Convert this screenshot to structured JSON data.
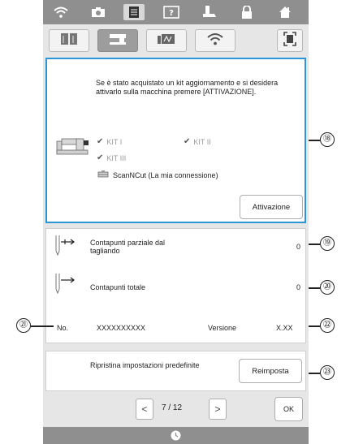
{
  "panel1": {
    "message": "Se è stato acquistato un kit aggiornamento e si desidera attivarlo sulla macchina premere [ATTIVAZIONE].",
    "kits": [
      "KIT I",
      "KIT II",
      "KIT III"
    ],
    "scanncut_label": "ScanNCut (La mia connessione)",
    "activate_label": "Attivazione"
  },
  "counters": {
    "partial_label": "Contapunti parziale dal tagliando",
    "partial_value": "0",
    "total_label": "Contapunti totale",
    "total_value": "0"
  },
  "info": {
    "no_label": "No.",
    "no_value": "XXXXXXXXXX",
    "version_label": "Versione",
    "version_value": "X.XX"
  },
  "reset": {
    "label": "Ripristina impostazioni predefinite",
    "button_label": "Reimposta"
  },
  "pagination": {
    "prev": "<",
    "current": "7",
    "separator": "/",
    "total": "12",
    "next": ">",
    "ok_label": "OK"
  },
  "callouts": [
    "⑱",
    "⑲",
    "⑳",
    "㉑",
    "㉒",
    "㉓"
  ],
  "icons": {
    "top": [
      "wifi-icon",
      "camera-icon",
      "settings-page-icon",
      "help-icon",
      "presser-foot-icon",
      "lock-icon",
      "home-icon"
    ],
    "tabs": [
      "book-settings-icon",
      "machine-settings-icon",
      "embroidery-settings-icon",
      "wireless-icon",
      "fullscreen-icon"
    ]
  },
  "colors": {
    "accent_border": "#2c95d6",
    "toolbar_bg": "#8f8f8f",
    "screen_bg": "#e6e6e6"
  }
}
